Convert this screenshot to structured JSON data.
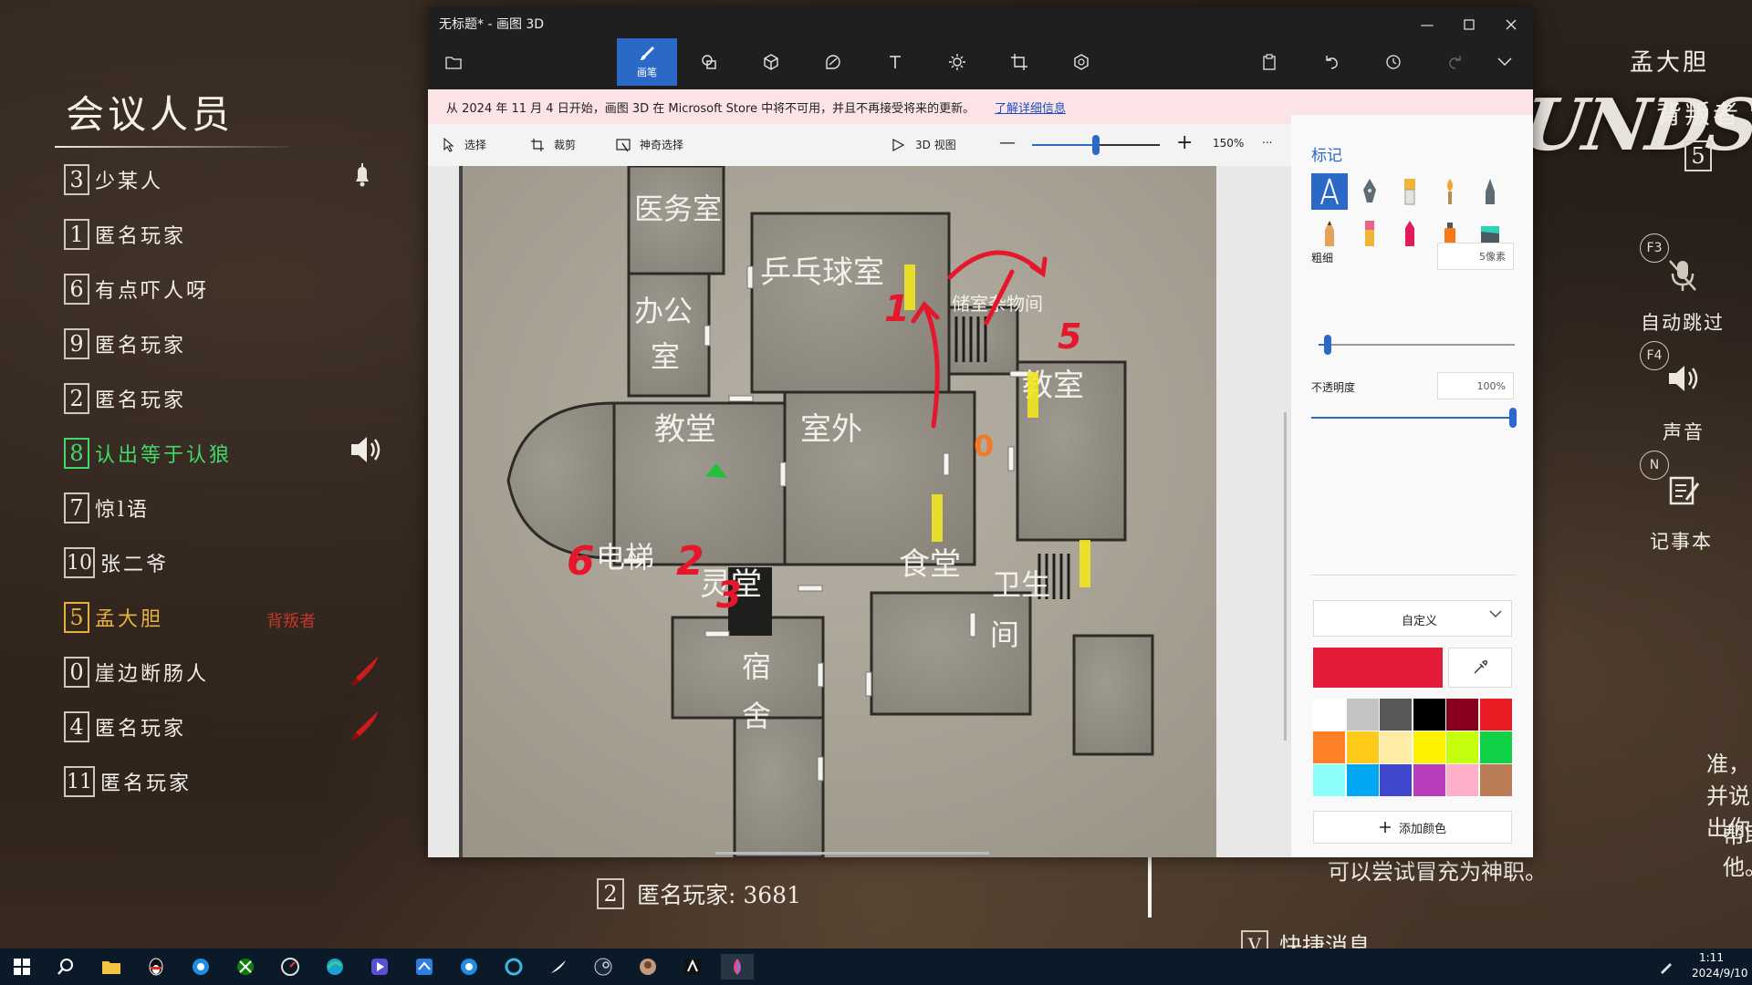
{
  "game": {
    "roster_title": "会议人员",
    "players": [
      {
        "num": "3",
        "name": "少某人",
        "style": "normal",
        "icon": "bell-icon"
      },
      {
        "num": "1",
        "name": "匿名玩家",
        "style": "normal"
      },
      {
        "num": "6",
        "name": "有点吓人呀",
        "style": "normal"
      },
      {
        "num": "9",
        "name": "匿名玩家",
        "style": "normal"
      },
      {
        "num": "2",
        "name": "匿名玩家",
        "style": "normal"
      },
      {
        "num": "8",
        "name": "认出等于认狼",
        "style": "green",
        "icon": "speaker-icon"
      },
      {
        "num": "7",
        "name": "惊l语",
        "style": "normal"
      },
      {
        "num": "10",
        "name": "张二爷",
        "style": "normal"
      },
      {
        "num": "5",
        "name": "孟大胆",
        "style": "gold",
        "tag": "背叛者"
      },
      {
        "num": "0",
        "name": "崖边断肠人",
        "style": "normal",
        "icon": "knife-icon"
      },
      {
        "num": "4",
        "name": "匿名玩家",
        "style": "normal",
        "icon": "knife-icon"
      },
      {
        "num": "11",
        "name": "匿名玩家",
        "style": "normal"
      }
    ],
    "hud": {
      "player_name": "孟大胆",
      "role": "背叛者",
      "player_num": "5",
      "logo_text": "UNDS",
      "keys": [
        {
          "key": "F3",
          "label": "自动跳过"
        },
        {
          "key": "F4",
          "label": "声音"
        },
        {
          "key": "N",
          "label": "记事本"
        }
      ]
    },
    "chat": {
      "line1": "准，并说出你",
      "line2": "帮助他。",
      "line3": "可以尝试冒充为神职。"
    },
    "vote": {
      "num": "2",
      "text": "匿名玩家: 3681"
    },
    "quick": {
      "key": "V",
      "text": "快捷消息"
    }
  },
  "paint3d": {
    "title": "无标题* - 画图 3D",
    "tools": [
      {
        "name": "brushes",
        "label": "画笔",
        "active": true
      },
      {
        "name": "2d-shapes"
      },
      {
        "name": "3d-shapes"
      },
      {
        "name": "stickers"
      },
      {
        "name": "text"
      },
      {
        "name": "effects"
      },
      {
        "name": "canvas"
      },
      {
        "name": "3d-library"
      }
    ],
    "banner": {
      "text": "从 2024 年 11 月 4 日开始，画图 3D 在 Microsoft Store 中将不可用，并且不再接受将来的更新。",
      "link": "了解详细信息"
    },
    "toolbar": {
      "select": "选择",
      "crop": "裁剪",
      "magic_select": "神奇选择",
      "view_3d": "3D 视图",
      "zoom": "150%",
      "zoom_fraction": 0.5,
      "more": "..."
    },
    "panel": {
      "title": "标记",
      "thickness_label": "粗细",
      "thickness_value": "5像素",
      "thickness_fraction": 0.03,
      "opacity_label": "不透明度",
      "opacity_value": "100%",
      "opacity_fraction": 1.0,
      "color_mode": "自定义",
      "current_color": "#e31b38",
      "add_color": "添加颜色",
      "palette": [
        "#ffffff",
        "#c3c3c3",
        "#585858",
        "#000000",
        "#88001b",
        "#ec1c24",
        "#ff7f27",
        "#ffca18",
        "#fdeca6",
        "#fff200",
        "#c4ff0e",
        "#0ed145",
        "#8cfffb",
        "#00a8f3",
        "#3f48cc",
        "#b83dba",
        "#ffaec8",
        "#b97a56"
      ]
    }
  },
  "map": {
    "rooms": {
      "infirmary": "医务室",
      "office_a": "办公",
      "office_b": "室",
      "pingpong": "乒乓球室",
      "storage": "储室杂物间",
      "church": "教堂",
      "outdoor": "室外",
      "classroom": "教室",
      "elevator": "电梯",
      "spirit_hall": "灵堂",
      "canteen": "食堂",
      "restroom_a": "卫生",
      "restroom_b": "间",
      "dorm_a": "宿",
      "dorm_b": "舍"
    },
    "marks": {
      "m1": "1",
      "m2": "2",
      "m3": "3",
      "m5": "5",
      "m6": "6",
      "m0": "0"
    }
  },
  "taskbar": {
    "time": "1:11",
    "date": "2024/9/10"
  }
}
